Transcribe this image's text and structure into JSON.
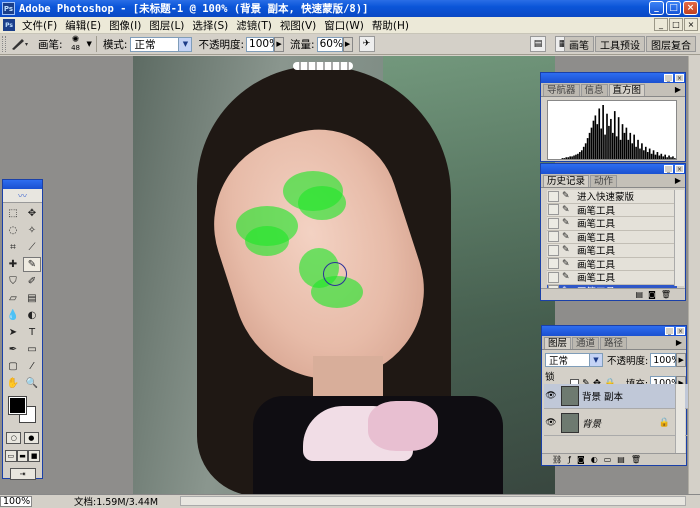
{
  "titlebar": {
    "logo": "Ps",
    "title": "Adobe Photoshop - [未标题-1 @ 100% (背景 副本, 快速蒙版/8)]",
    "minimize": "_",
    "maximize": "□",
    "close": "×"
  },
  "menubar": {
    "items": [
      "文件(F)",
      "编辑(E)",
      "图像(I)",
      "图层(L)",
      "选择(S)",
      "滤镜(T)",
      "视图(V)",
      "窗口(W)",
      "帮助(H)"
    ],
    "win": [
      "_",
      "□",
      "×"
    ]
  },
  "options": {
    "brush_label": "画笔:",
    "brush_size": "48",
    "mode_label": "模式:",
    "mode_value": "正常",
    "opacity_label": "不透明度:",
    "opacity_value": "100%",
    "flow_label": "流量:",
    "flow_value": "60%",
    "well_tabs": [
      "画笔",
      "工具预设",
      "图层复合"
    ]
  },
  "navigator_panel": {
    "tabs": [
      "导航器",
      "信息",
      "直方图"
    ],
    "histogram_bars": [
      0,
      0,
      0,
      0,
      0,
      0,
      0,
      1,
      1,
      2,
      2,
      3,
      3,
      4,
      5,
      6,
      8,
      10,
      14,
      18,
      24,
      30,
      36,
      44,
      50,
      40,
      58,
      35,
      62,
      28,
      52,
      38,
      46,
      30,
      55,
      26,
      48,
      22,
      40,
      30,
      36,
      22,
      30,
      18,
      28,
      14,
      22,
      12,
      18,
      10,
      14,
      8,
      12,
      6,
      10,
      5,
      8,
      4,
      6,
      3,
      5,
      2,
      4,
      2,
      3,
      1
    ]
  },
  "history_panel": {
    "tabs": [
      "历史记录",
      "动作"
    ],
    "items": [
      "进入快速蒙版",
      "画笔工具",
      "画笔工具",
      "画笔工具",
      "画笔工具",
      "画笔工具",
      "画笔工具",
      "画笔工具"
    ],
    "selected_index": 7
  },
  "layers_panel": {
    "tabs": [
      "图层",
      "通道",
      "路径"
    ],
    "blend_mode": "正常",
    "opacity_label": "不透明度:",
    "opacity_value": "100%",
    "lock_label": "锁定:",
    "fill_label": "填充:",
    "fill_value": "100%",
    "layers": [
      {
        "name": "背景 副本",
        "selected": true,
        "locked": false
      },
      {
        "name": "背景",
        "selected": false,
        "locked": true
      }
    ]
  },
  "statusbar": {
    "zoom": "100%",
    "doc_info": "文档:1.59M/3.44M"
  },
  "colors": {
    "quickmask_green": "#1ee628",
    "selection_blue": "#2f57c8",
    "titlebar_blue": "#0b55d8"
  }
}
